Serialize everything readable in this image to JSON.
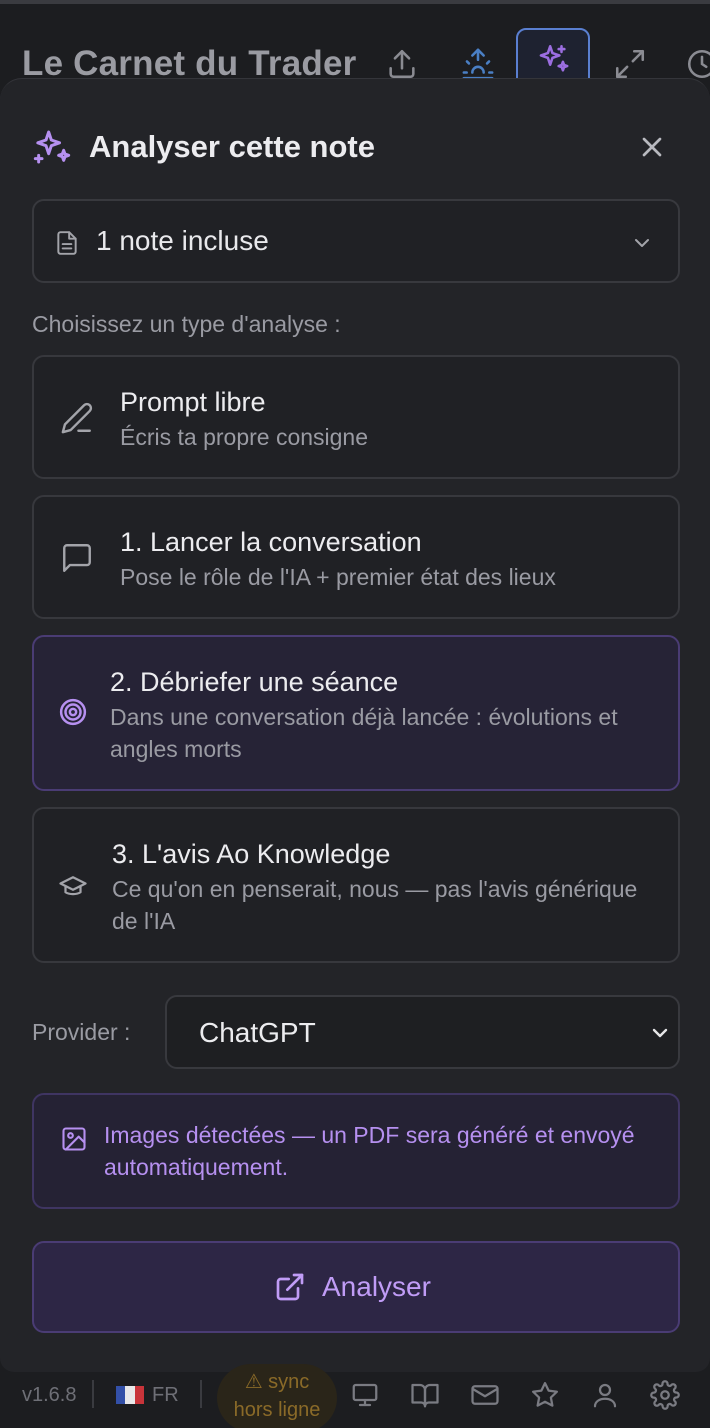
{
  "app": {
    "title": "Le Carnet du Trader"
  },
  "dialog": {
    "title": "Analyser cette note",
    "notes_selector": "1 note incluse",
    "choose_label": "Choisissez un type d'analyse :",
    "options": [
      {
        "title": "Prompt libre",
        "subtitle": "Écris ta propre consigne",
        "icon": "pencil-icon"
      },
      {
        "title": "1. Lancer la conversation",
        "subtitle": "Pose le rôle de l'IA + premier état des lieux",
        "icon": "chat-bubble-icon"
      },
      {
        "title": "2. Débriefer une séance",
        "subtitle": "Dans une conversation déjà lancée : évolutions et angles morts",
        "icon": "target-icon",
        "selected": true
      },
      {
        "title": "3. L'avis Ao Knowledge",
        "subtitle": "Ce qu'on en penserait, nous — pas l'avis générique de l'IA",
        "icon": "graduation-cap-icon"
      }
    ],
    "provider_label": "Provider :",
    "provider_value": "ChatGPT",
    "info_text": "Images détectées — un PDF sera généré et envoyé automatiquement.",
    "analyze_label": "Analyser"
  },
  "footer": {
    "version": "v1.6.8",
    "lang": "FR",
    "sync_line1": "⚠ sync",
    "sync_line2": "hors ligne"
  },
  "colors": {
    "accent": "#b690f0",
    "panel_bg": "#232428",
    "page_bg": "#1c1d20"
  }
}
